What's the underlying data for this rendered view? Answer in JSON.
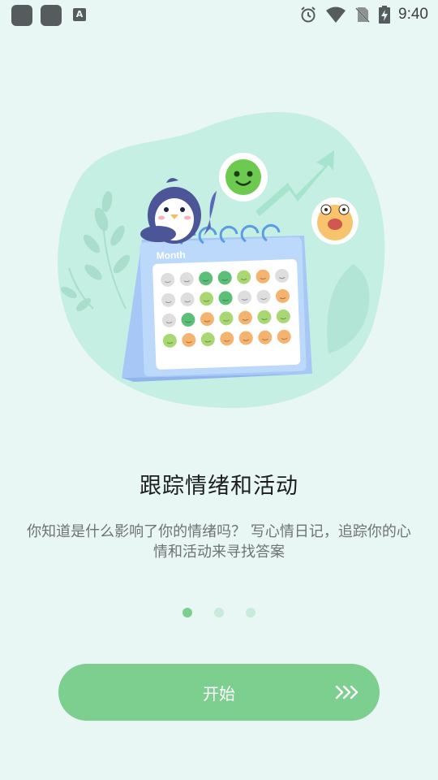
{
  "status_bar": {
    "time": "9:40",
    "a_badge": "A"
  },
  "illustration": {
    "calendar_label": "Month"
  },
  "onboarding": {
    "title": "跟踪情绪和活动",
    "description": "你知道是什么影响了你的情绪吗？ 写心情日记，追踪你的心情和活动来寻找答案",
    "page_index": 1,
    "page_count": 3
  },
  "start_button": {
    "label": "开始"
  },
  "colors": {
    "background": "#e8f7f4",
    "accent": "#7dcf90",
    "dot_inactive": "#c8ebdc"
  }
}
